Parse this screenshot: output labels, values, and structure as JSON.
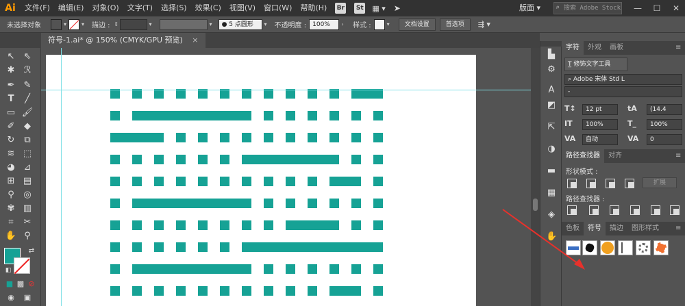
{
  "app": {
    "logo": "Ai"
  },
  "menu": [
    "文件(F)",
    "编辑(E)",
    "对象(O)",
    "文字(T)",
    "选择(S)",
    "效果(C)",
    "视图(V)",
    "窗口(W)",
    "帮助(H)"
  ],
  "menu_badges": [
    "Br",
    "St"
  ],
  "workspace_label": "版面",
  "stock_search_placeholder": "搜索 Adobe Stock",
  "controlbar": {
    "selection_label": "未选择对象",
    "stroke_label": "描边 :",
    "brush_label": "5 点圆形",
    "opacity_label": "不透明度 :",
    "opacity_value": "100%",
    "style_label": "样式 :",
    "doc_setup": "文档设置",
    "prefs": "首选项"
  },
  "document_tab": {
    "title": "符号-1.ai* @ 150% (CMYK/GPU 预览)",
    "close": "×"
  },
  "character_panel": {
    "tabs": [
      "字符",
      "外观",
      "画板"
    ],
    "touch_type_button": "修饰文字工具",
    "font_family": "Adobe 宋体 Std L",
    "font_style": "-",
    "font_size": "12 pt",
    "leading": "(14.4",
    "vert_scale": "100%",
    "horiz_scale": "100%",
    "kerning": "自动",
    "tracking": "0"
  },
  "pathfinder_panel": {
    "tabs": [
      "路径查找器",
      "对齐"
    ],
    "shape_modes_label": "形状模式 :",
    "pathfinders_label": "路径查找器 :",
    "expand_button": "扩展"
  },
  "symbols_panel": {
    "tabs": [
      "色板",
      "符号",
      "描边",
      "图形样式"
    ]
  },
  "colors": {
    "accent_teal": "#16a295",
    "menu_bg": "#323232",
    "panel_bg": "#535353",
    "arrow_red": "#e8312b"
  },
  "icons": {
    "toolbar": [
      "selection-tool-icon",
      "direct-selection-tool-icon",
      "magic-wand-icon",
      "lasso-icon",
      "pen-tool-icon",
      "curvature-icon",
      "type-tool-icon",
      "line-tool-icon",
      "rectangle-tool-icon",
      "paintbrush-icon",
      "shaper-icon",
      "eraser-icon",
      "rotate-icon",
      "scale-icon",
      "width-tool-icon",
      "free-transform-icon",
      "shape-builder-icon",
      "perspective-grid-icon",
      "mesh-icon",
      "gradient-icon",
      "eyedropper-icon",
      "blend-icon",
      "symbol-sprayer-icon",
      "graph-icon",
      "artboard-tool-icon",
      "slice-icon",
      "hand-icon",
      "zoom-icon"
    ],
    "dock": [
      "libraries-icon",
      "color-guide-icon",
      "type-icon",
      "image-trace-icon",
      "export-icon",
      "transparency-icon",
      "gradient-panel-icon",
      "color-icon",
      "brushes-icon",
      "layers-icon",
      "puppet-icon"
    ]
  }
}
